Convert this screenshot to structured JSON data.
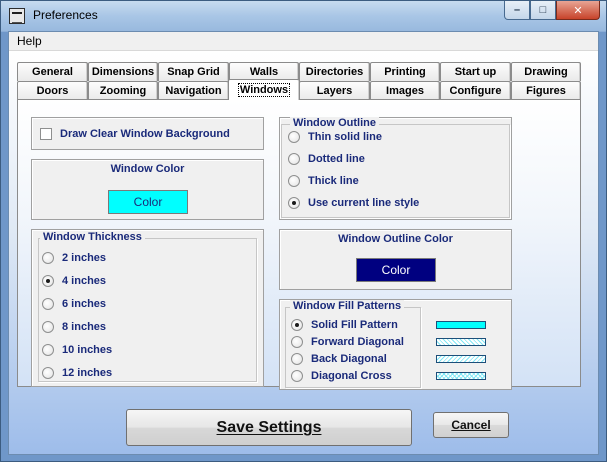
{
  "window": {
    "title": "Preferences",
    "controls": {
      "minimize": "–",
      "maximize": "□",
      "close": "✕"
    }
  },
  "menu": {
    "help": "Help"
  },
  "tabs": {
    "row1": [
      "General",
      "Dimensions",
      "Snap Grid",
      "Walls",
      "Directories",
      "Printing",
      "Start up",
      "Drawing"
    ],
    "row2": [
      "Doors",
      "Zooming",
      "Navigation",
      "Windows",
      "Layers",
      "Images",
      "Configure",
      "Figures"
    ],
    "active": "Windows"
  },
  "windows_page": {
    "draw_clear_bg": {
      "label": "Draw Clear Window Background",
      "checked": false
    },
    "window_color": {
      "title": "Window Color",
      "button": "Color",
      "color": "#00ffff"
    },
    "window_thickness": {
      "legend": "Window Thickness",
      "options": [
        "2 inches",
        "4 inches",
        "6 inches",
        "8 inches",
        "10 inches",
        "12 inches"
      ],
      "selected": "4 inches"
    },
    "window_outline": {
      "legend": "Window Outline",
      "options": [
        "Thin solid line",
        "Dotted line",
        "Thick line",
        "Use current line style"
      ],
      "selected": "Use current line style"
    },
    "outline_color": {
      "title": "Window Outline Color",
      "button": "Color",
      "color": "#000080"
    },
    "fill_patterns": {
      "legend": "Window Fill Patterns",
      "options": [
        "Solid Fill Pattern",
        "Forward Diagonal",
        "Back Diagonal",
        "Diagonal Cross"
      ],
      "selected": "Solid Fill Pattern"
    }
  },
  "footer": {
    "save": "Save Settings",
    "cancel": "Cancel"
  },
  "colors": {
    "accent_text": "#1a2a7a",
    "cyan": "#00ffff",
    "navy": "#000080"
  }
}
